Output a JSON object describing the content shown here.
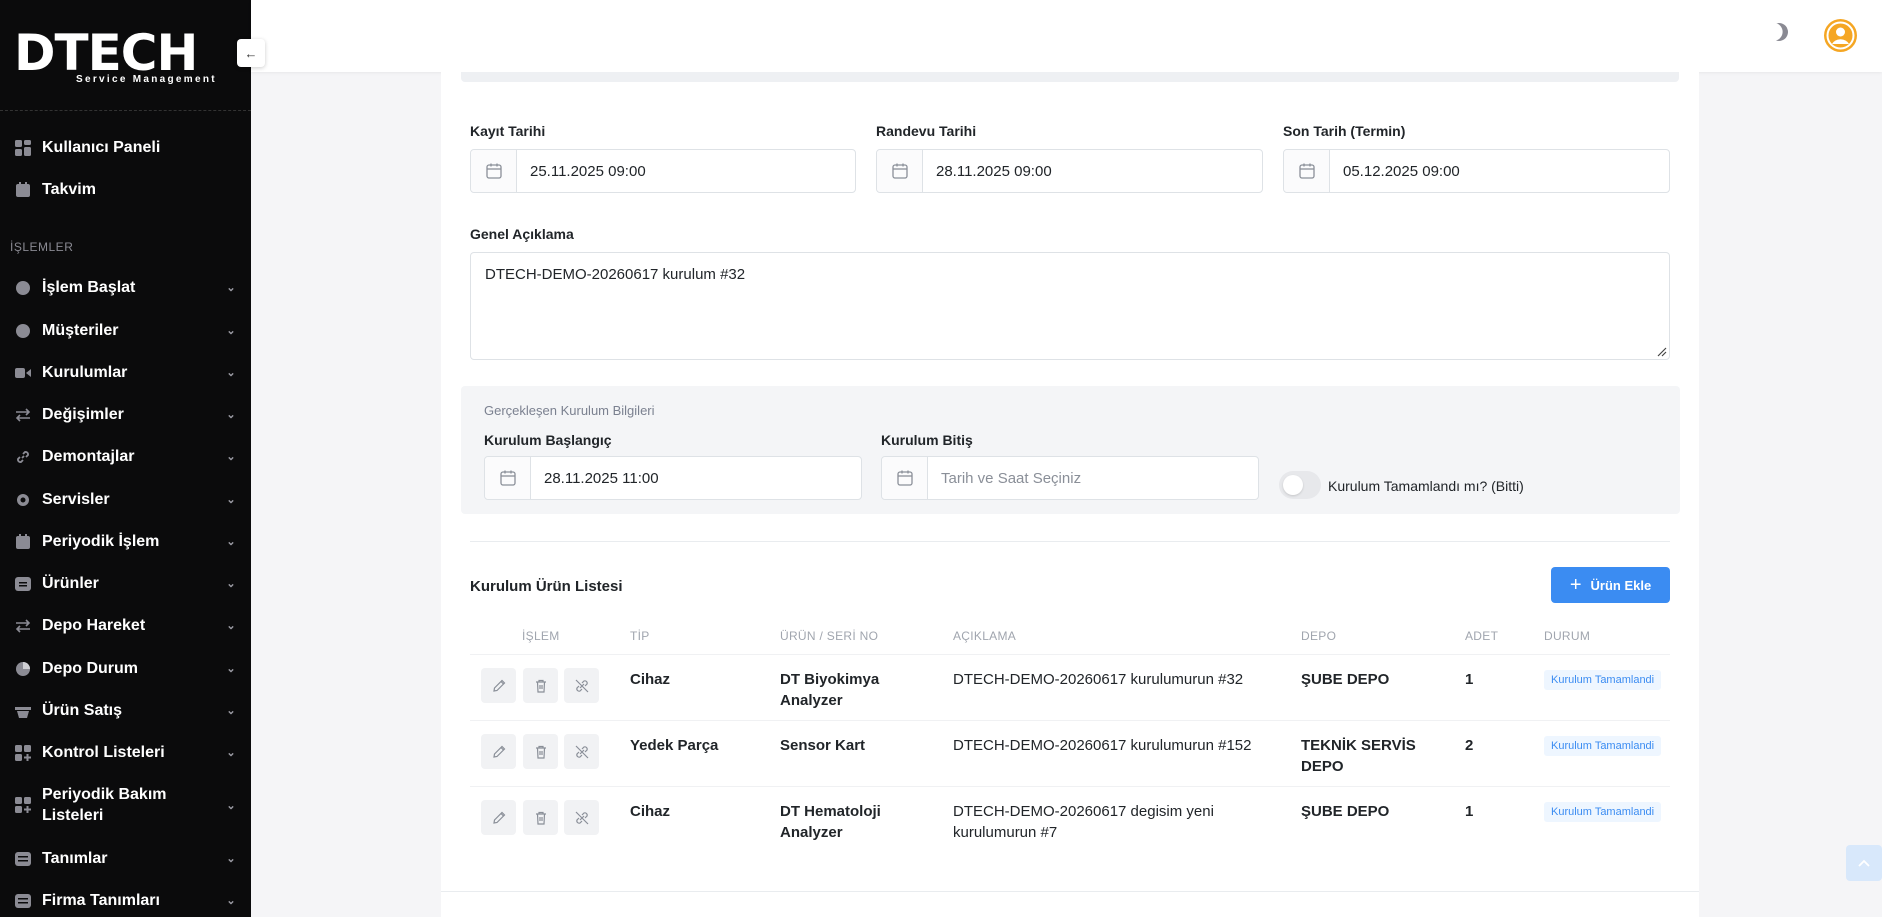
{
  "logo": {
    "text": "DTECH",
    "subtitle": "Service Management"
  },
  "sidebar": {
    "section_label": "İŞLEMLER",
    "top_items": [
      {
        "label": "Kullanıcı Paneli",
        "icon": "dashboard-icon"
      },
      {
        "label": "Takvim",
        "icon": "calendar-icon"
      }
    ],
    "items": [
      {
        "label": "İşlem Başlat",
        "icon": "bolt-icon"
      },
      {
        "label": "Müşteriler",
        "icon": "user-icon"
      },
      {
        "label": "Kurulumlar",
        "icon": "video-icon"
      },
      {
        "label": "Değişimler",
        "icon": "swap-icon"
      },
      {
        "label": "Demontajlar",
        "icon": "link-icon"
      },
      {
        "label": "Servisler",
        "icon": "settings-icon"
      },
      {
        "label": "Periyodik İşlem",
        "icon": "calendar-icon"
      },
      {
        "label": "Ürünler",
        "icon": "box-icon"
      },
      {
        "label": "Depo Hareket",
        "icon": "swap-icon"
      },
      {
        "label": "Depo Durum",
        "icon": "pie-icon"
      },
      {
        "label": "Ürün Satış",
        "icon": "basket-icon"
      },
      {
        "label": "Kontrol Listeleri",
        "icon": "grid-plus-icon"
      },
      {
        "label": "Periyodik Bakım Listeleri",
        "icon": "grid-plus-icon"
      },
      {
        "label": "Tanımlar",
        "icon": "list-icon"
      },
      {
        "label": "Firma Tanımları",
        "icon": "list-icon"
      }
    ]
  },
  "form": {
    "kayit_label": "Kayıt Tarihi",
    "kayit_value": "25.11.2025 09:00",
    "randevu_label": "Randevu Tarihi",
    "randevu_value": "28.11.2025 09:00",
    "son_label": "Son Tarih (Termin)",
    "son_value": "05.12.2025 09:00",
    "aciklama_label": "Genel Açıklama",
    "aciklama_value": "DTECH-DEMO-20260617 kurulum #32"
  },
  "kurulum_info": {
    "title": "Gerçekleşen Kurulum Bilgileri",
    "baslangic_label": "Kurulum Başlangıç",
    "baslangic_value": "28.11.2025 11:00",
    "bitis_label": "Kurulum Bitiş",
    "bitis_placeholder": "Tarih ve Saat Seçiniz",
    "toggle_label": "Kurulum Tamamlandı mı? (Bitti)",
    "toggle_on": false
  },
  "product_list": {
    "title": "Kurulum Ürün Listesi",
    "add_button": "Ürün Ekle",
    "headers": [
      "İŞLEM",
      "TİP",
      "ÜRÜN / SERİ NO",
      "AÇIKLAMA",
      "DEPO",
      "ADET",
      "DURUM"
    ],
    "rows": [
      {
        "tip": "Cihaz",
        "urun": "DT Biyokimya Analyzer",
        "aciklama": "DTECH-DEMO-20260617 kurulumurun #32",
        "depo": "ŞUBE DEPO",
        "adet": "1",
        "durum": "Kurulum Tamamlandi"
      },
      {
        "tip": "Yedek Parça",
        "urun": "Sensor Kart",
        "aciklama": "DTECH-DEMO-20260617 kurulumurun #152",
        "depo": "TEKNİK SERVİS DEPO",
        "adet": "2",
        "durum": "Kurulum Tamamlandi"
      },
      {
        "tip": "Cihaz",
        "urun": "DT Hematoloji Analyzer",
        "aciklama": "DTECH-DEMO-20260617 degisim yeni kurulumurun #7",
        "depo": "ŞUBE DEPO",
        "adet": "1",
        "durum": "Kurulum Tamamlandi"
      }
    ]
  },
  "colors": {
    "accent": "#3b8cf2",
    "sidebar_bg": "#0b0b0c",
    "avatar": "#f5a623"
  }
}
